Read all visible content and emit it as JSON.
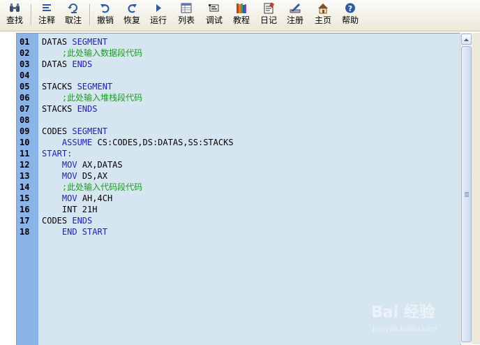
{
  "toolbar": {
    "items": [
      {
        "label": "查找",
        "icon": "binoculars-icon"
      },
      {
        "label": "注释",
        "icon": "comment-icon"
      },
      {
        "label": "取注",
        "icon": "uncomment-icon"
      },
      {
        "label": "撤销",
        "icon": "undo-icon"
      },
      {
        "label": "恢复",
        "icon": "redo-icon"
      },
      {
        "label": "运行",
        "icon": "run-icon"
      },
      {
        "label": "列表",
        "icon": "list-icon"
      },
      {
        "label": "调试",
        "icon": "debug-icon"
      },
      {
        "label": "教程",
        "icon": "books-icon"
      },
      {
        "label": "日记",
        "icon": "diary-icon"
      },
      {
        "label": "注册",
        "icon": "register-icon"
      },
      {
        "label": "主页",
        "icon": "home-icon"
      },
      {
        "label": "帮助",
        "icon": "help-icon"
      }
    ]
  },
  "editor": {
    "lines": [
      {
        "n": "01",
        "parts": [
          {
            "t": "DATAS ",
            "c": "tx"
          },
          {
            "t": "SEGMENT",
            "c": "kw"
          }
        ]
      },
      {
        "n": "02",
        "parts": [
          {
            "t": "    ;此处输入数据段代码",
            "c": "cm"
          }
        ]
      },
      {
        "n": "03",
        "parts": [
          {
            "t": "DATAS ",
            "c": "tx"
          },
          {
            "t": "ENDS",
            "c": "kw"
          }
        ]
      },
      {
        "n": "04",
        "parts": []
      },
      {
        "n": "05",
        "parts": [
          {
            "t": "STACKS ",
            "c": "tx"
          },
          {
            "t": "SEGMENT",
            "c": "kw"
          }
        ]
      },
      {
        "n": "06",
        "parts": [
          {
            "t": "    ;此处输入堆栈段代码",
            "c": "cm"
          }
        ]
      },
      {
        "n": "07",
        "parts": [
          {
            "t": "STACKS ",
            "c": "tx"
          },
          {
            "t": "ENDS",
            "c": "kw"
          }
        ]
      },
      {
        "n": "08",
        "parts": []
      },
      {
        "n": "09",
        "parts": [
          {
            "t": "CODES ",
            "c": "tx"
          },
          {
            "t": "SEGMENT",
            "c": "kw"
          }
        ]
      },
      {
        "n": "10",
        "parts": [
          {
            "t": "    ",
            "c": "tx"
          },
          {
            "t": "ASSUME",
            "c": "kw"
          },
          {
            "t": " CS:CODES,DS:DATAS,SS:STACKS",
            "c": "tx"
          }
        ]
      },
      {
        "n": "11",
        "parts": [
          {
            "t": "START:",
            "c": "kw"
          }
        ]
      },
      {
        "n": "12",
        "parts": [
          {
            "t": "    ",
            "c": "tx"
          },
          {
            "t": "MOV",
            "c": "kw"
          },
          {
            "t": " AX,DATAS",
            "c": "tx"
          }
        ]
      },
      {
        "n": "13",
        "parts": [
          {
            "t": "    ",
            "c": "tx"
          },
          {
            "t": "MOV",
            "c": "kw"
          },
          {
            "t": " DS,AX",
            "c": "tx"
          }
        ]
      },
      {
        "n": "14",
        "parts": [
          {
            "t": "    ;此处输入代码段代码",
            "c": "cm"
          }
        ]
      },
      {
        "n": "15",
        "parts": [
          {
            "t": "    ",
            "c": "tx"
          },
          {
            "t": "MOV",
            "c": "kw"
          },
          {
            "t": " AH,4CH",
            "c": "tx"
          }
        ]
      },
      {
        "n": "16",
        "parts": [
          {
            "t": "    INT 21H",
            "c": "tx"
          }
        ]
      },
      {
        "n": "17",
        "parts": [
          {
            "t": "CODES ",
            "c": "tx"
          },
          {
            "t": "ENDS",
            "c": "kw"
          }
        ]
      },
      {
        "n": "18",
        "parts": [
          {
            "t": "    ",
            "c": "tx"
          },
          {
            "t": "END START",
            "c": "kw"
          }
        ]
      }
    ]
  },
  "watermark": {
    "brand": "Bai 经验",
    "url": "jingyan.baidu.com"
  },
  "colors": {
    "keyword": "#1d1dbe",
    "comment": "#16a016",
    "gutter": "#8ab3e8",
    "editor_bg": "#d6e6f0"
  }
}
